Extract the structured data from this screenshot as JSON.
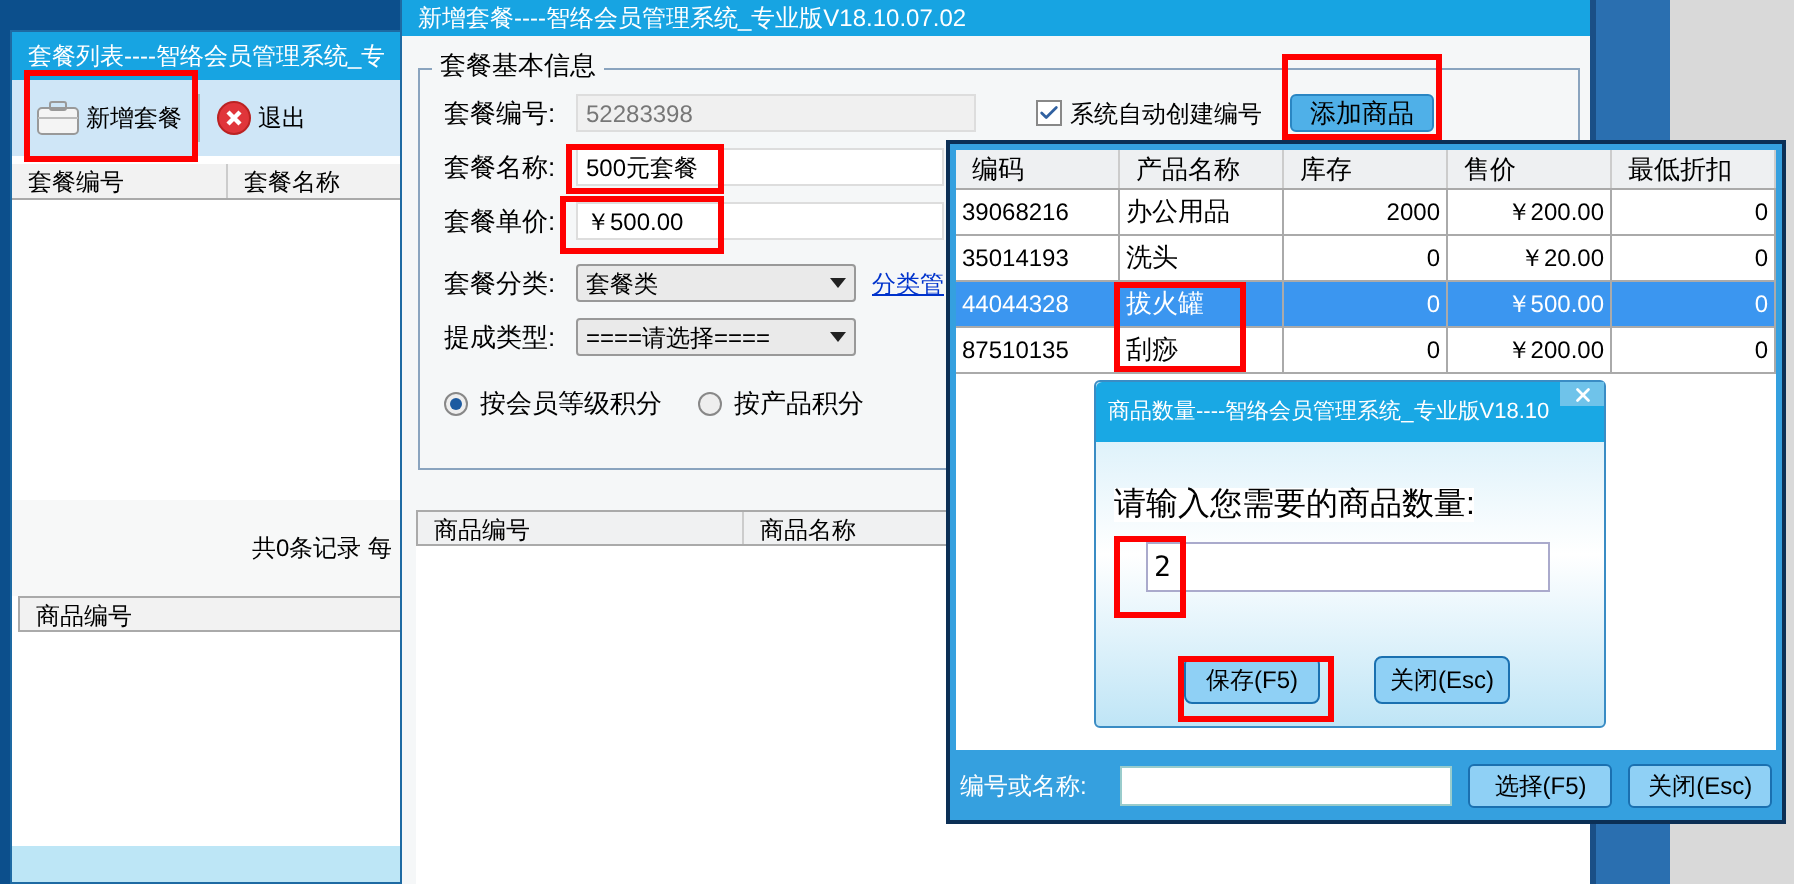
{
  "list_window": {
    "title": "套餐列表----智络会员管理系统_专",
    "toolbar": [
      {
        "label": "新增套餐",
        "kind": "new"
      },
      {
        "label": "退出",
        "kind": "exit"
      }
    ],
    "columns": [
      "套餐编号",
      "套餐名称"
    ],
    "footer": "共0条记录  每",
    "detail_columns": [
      "商品编号"
    ]
  },
  "edit_window": {
    "title": "新增套餐----智络会员管理系统_专业版V18.10.07.02",
    "group_title": "套餐基本信息",
    "code_label": "套餐编号:",
    "code_value": "52283398",
    "auto_code": {
      "label": "系统自动创建编号",
      "checked": true
    },
    "add_button": "添加商品",
    "name_label": "套餐名称:",
    "name_value": "500元套餐",
    "price_label": "套餐单价:",
    "price_value": "￥500.00",
    "category_label": "套餐分类:",
    "category_value": "套餐类",
    "category_link": "分类管",
    "commission_label": "提成类型:",
    "commission_value": "====请选择====",
    "point_modes": [
      {
        "label": "按会员等级积分",
        "selected": true
      },
      {
        "label": "按产品积分",
        "selected": false
      }
    ],
    "item_columns": [
      "商品编号",
      "商品名称"
    ]
  },
  "picker": {
    "columns": [
      "编码",
      "产品名称",
      "库存",
      "售价",
      "最低折扣"
    ],
    "rows": [
      {
        "cells": [
          "39068216",
          "办公用品",
          "2000",
          "￥200.00",
          "0"
        ],
        "selected": false
      },
      {
        "cells": [
          "35014193",
          "洗头",
          "0",
          "￥20.00",
          "0"
        ],
        "selected": false
      },
      {
        "cells": [
          "44044328",
          "拔火罐",
          "0",
          "￥500.00",
          "0"
        ],
        "selected": true
      },
      {
        "cells": [
          "87510135",
          "刮痧",
          "0",
          "￥200.00",
          "0"
        ],
        "selected": false
      }
    ],
    "search_label": "编号或名称:",
    "buttons": [
      "选择(F5)",
      "关闭(Esc)"
    ]
  },
  "quantity_dialog": {
    "title": "商品数量----智络会员管理系统_专业版V18.10",
    "prompt": "请输入您需要的商品数量:",
    "value": "2",
    "buttons": [
      "保存(F5)",
      "关闭(Esc)"
    ]
  }
}
